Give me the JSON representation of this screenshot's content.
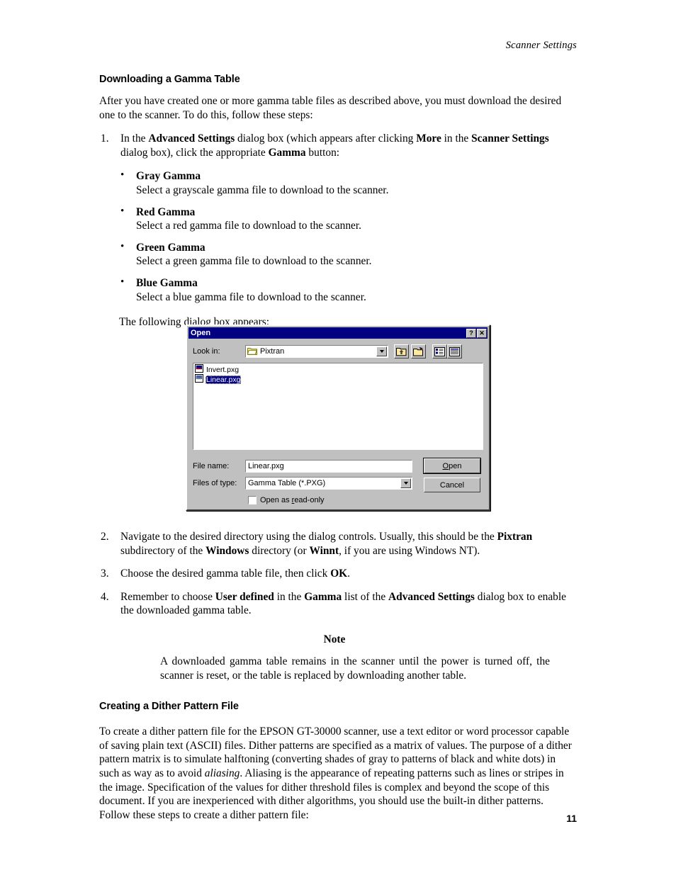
{
  "running_head": "Scanner Settings",
  "page_number": "11",
  "sections": [
    {
      "heading": "Downloading a Gamma Table",
      "intro": "After you have created one or more gamma table files as described above, you must download the desired one to the scanner. To do this, follow these steps:"
    }
  ],
  "step1": {
    "number": "1.",
    "part1": "In the ",
    "bold1": "Advanced Settings",
    "part2": " dialog box (which appears after clicking ",
    "bold2": "More",
    "part3": " in the ",
    "bold3": "Scanner Settings",
    "part4": " dialog box), click the appropriate ",
    "bold4": "Gamma",
    "part5": " button:"
  },
  "gamma_options": [
    {
      "bullet": "•",
      "term": "Gray Gamma",
      "desc": "Select a grayscale gamma file to download to the scanner."
    },
    {
      "bullet": "•",
      "term": "Red Gamma",
      "desc": "Select a red gamma file to download to the scanner."
    },
    {
      "bullet": "•",
      "term": "Green Gamma",
      "desc": "Select a green gamma file to download to the scanner."
    },
    {
      "bullet": "•",
      "term": "Blue Gamma",
      "desc": "Select a blue gamma file to download to the scanner."
    }
  ],
  "lead_in": "The following dialog box appears:",
  "dialog": {
    "title": "Open",
    "help_button": "?",
    "close_button": "✕",
    "lookin_label": "Look in:",
    "lookin_value": "Pixtran",
    "lookin_icon": "folder-open-icon",
    "toolbar": [
      {
        "name": "up-one-level-icon",
        "tip": "Up One Level"
      },
      {
        "name": "new-folder-icon",
        "tip": "Create New Folder"
      },
      {
        "name": "list-view-icon",
        "tip": "List"
      },
      {
        "name": "details-view-icon",
        "tip": "Details"
      }
    ],
    "files": [
      {
        "name": "Invert.pxg",
        "selected": false
      },
      {
        "name": "Linear.pxg",
        "selected": true
      }
    ],
    "filename_label": "File name:",
    "filename_value": "Linear.pxg",
    "filetype_label": "Files of type:",
    "filetype_value": "Gamma Table (*.PXG)",
    "readonly_label_pre": "Open as ",
    "readonly_label_u": "r",
    "readonly_label_post": "ead-only",
    "open_button_u": "O",
    "open_button_rest": "pen",
    "cancel_button": "Cancel",
    "colors": {
      "titlebar": "#000080",
      "face": "#c0c0c0",
      "selection": "#000080",
      "field": "#ffffff"
    }
  },
  "step2": {
    "number": "2.",
    "part1": "Navigate to the desired directory using the dialog controls. Usually, this should be the ",
    "bold1": "Pixtran",
    "part2": " subdirectory of the ",
    "bold2": "Windows",
    "part3": " directory (or ",
    "bold3": "Winnt",
    "part4": ", if you are using Windows NT)."
  },
  "step3": {
    "number": "3.",
    "part1": "Choose the desired gamma table file, then click ",
    "bold1": "OK",
    "part2": "."
  },
  "step4": {
    "number": "4.",
    "part1": "Remember to choose ",
    "bold1": "User defined",
    "part2": " in the ",
    "bold2": "Gamma",
    "part3": " list of the ",
    "bold3": "Advanced Settings",
    "part4": " dialog box to enable the downloaded gamma table."
  },
  "note": {
    "title": "Note",
    "body": "A downloaded gamma table remains in the scanner until the power is turned off, the scanner is reset, or the table is replaced by downloading another table."
  },
  "section2": {
    "heading": "Creating a Dither Pattern File",
    "para_part1": "To create a dither pattern file for the EPSON GT-30000 scanner, use a text editor or word processor capable of saving plain text (ASCII) files. Dither patterns are specified as a matrix of values. The purpose of a dither pattern matrix is to simulate halftoning (converting shades of gray to patterns of black and white dots) in such as way as to avoid ",
    "italic1": "aliasing",
    "para_part2": ". Aliasing is the appearance of repeating patterns such as lines or stripes in the image. Specification of the values for dither threshold files is complex and beyond the scope of this document. If you are inexperienced with dither algorithms, you should use the built-in dither patterns. Follow these steps to create a dither pattern file:"
  }
}
